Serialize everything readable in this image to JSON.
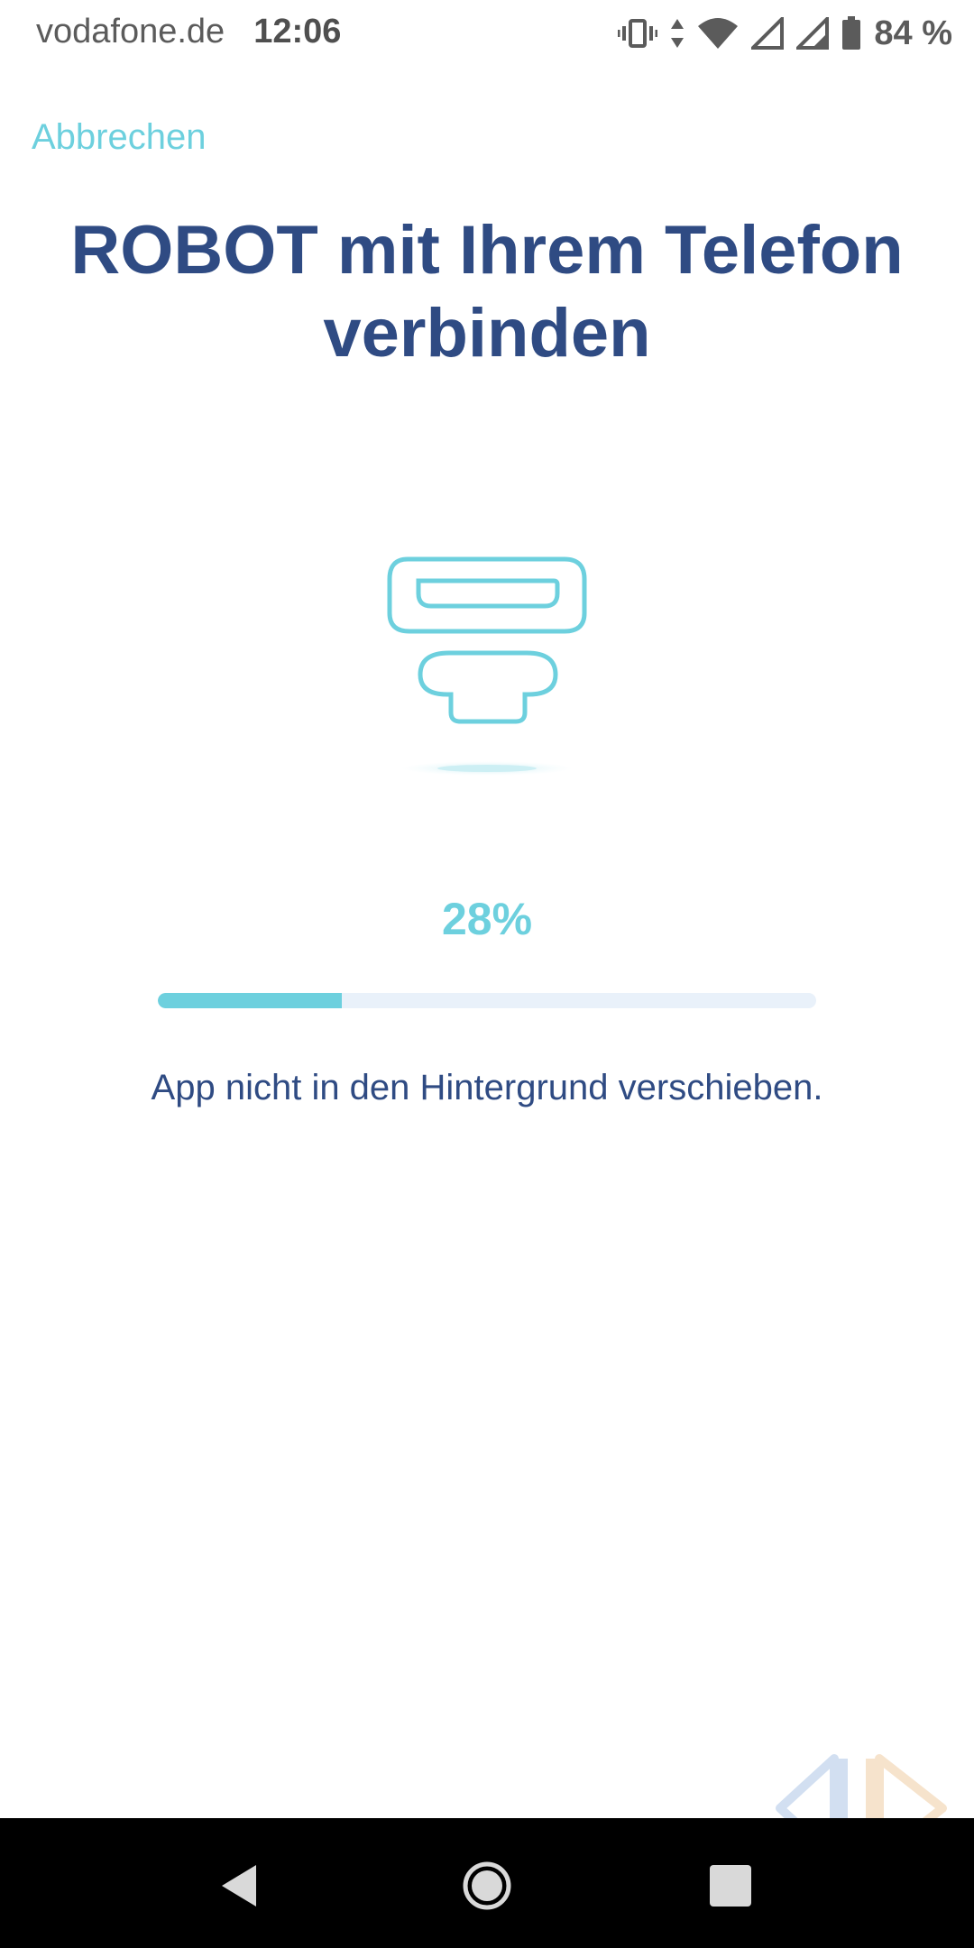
{
  "status_bar": {
    "carrier": "vodafone.de",
    "time": "12:06",
    "battery_percent": "84 %",
    "icons": [
      "vibrate-icon",
      "data-arrows-icon",
      "wifi-icon",
      "signal-icon",
      "signal-icon",
      "battery-icon"
    ]
  },
  "header": {
    "cancel_label": "Abbrechen"
  },
  "main": {
    "title": "ROBOT mit Ihrem Telefon verbinden",
    "illustration_icon": "robot-connect-icon",
    "progress_label": "28%",
    "progress_value": 0.28,
    "hint": "App nicht in den Hintergrund verschieben."
  },
  "nav_bar": {
    "buttons": [
      "back-icon",
      "home-icon",
      "recents-icon"
    ]
  },
  "colors": {
    "accent": "#6dd0de",
    "title": "#2f4b83",
    "track": "#e9f1fa",
    "nav_background": "#000000"
  }
}
